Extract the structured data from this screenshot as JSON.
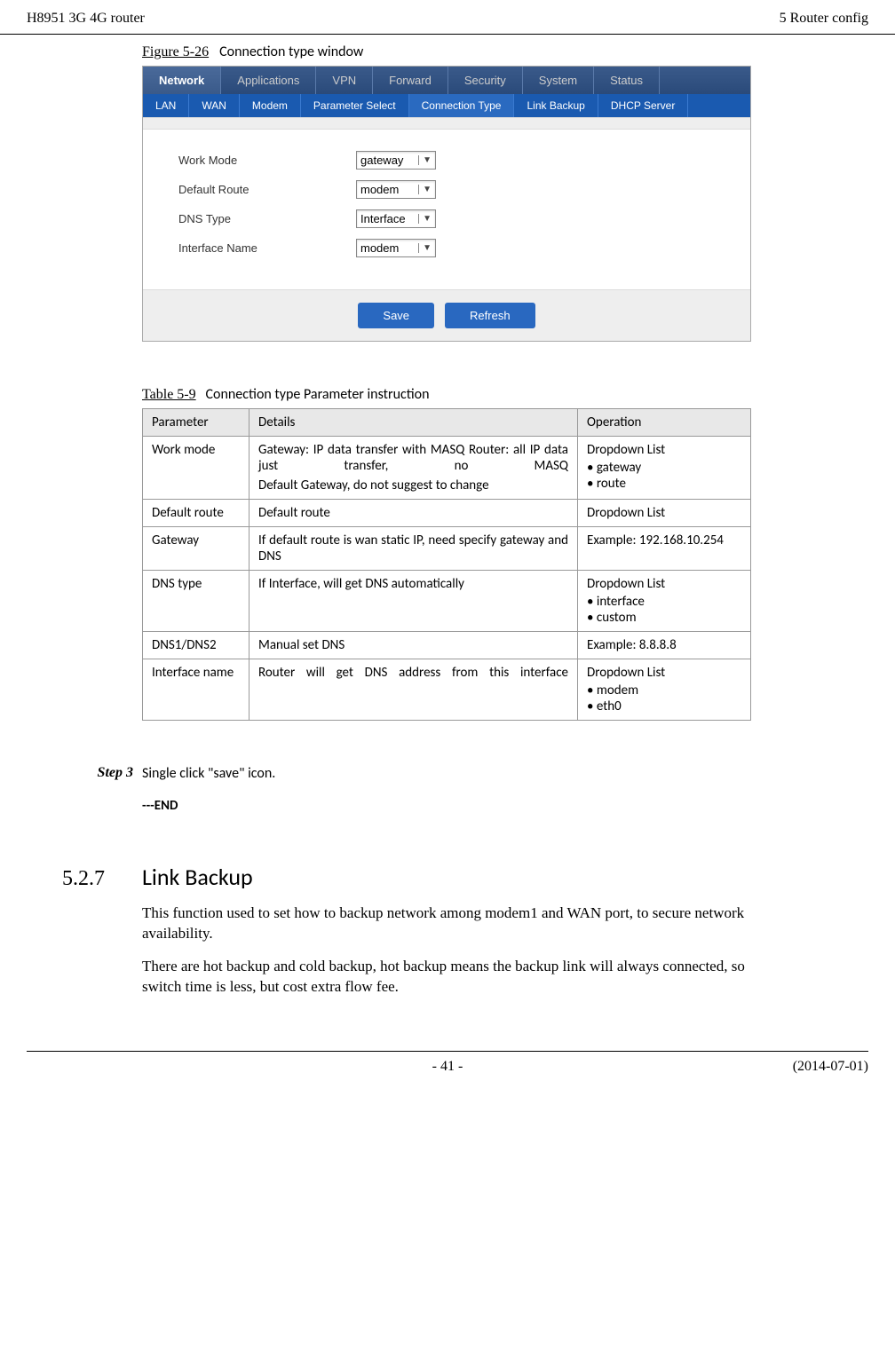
{
  "header": {
    "left": "H8951 3G 4G router",
    "right": "5  Router config"
  },
  "figure": {
    "label": "Figure 5-26",
    "title": "Connection type window"
  },
  "main_tabs": [
    "Network",
    "Applications",
    "VPN",
    "Forward",
    "Security",
    "System",
    "Status"
  ],
  "main_tab_active_index": 0,
  "sub_tabs": [
    "LAN",
    "WAN",
    "Modem",
    "Parameter Select",
    "Connection Type",
    "Link Backup",
    "DHCP Server"
  ],
  "sub_tab_active_index": 4,
  "form_fields": [
    {
      "label": "Work Mode",
      "value": "gateway"
    },
    {
      "label": "Default Route",
      "value": "modem"
    },
    {
      "label": "DNS Type",
      "value": "Interface"
    },
    {
      "label": "Interface Name",
      "value": "modem"
    }
  ],
  "buttons": {
    "save": "Save",
    "refresh": "Refresh"
  },
  "table": {
    "label": "Table 5-9",
    "title": "Connection type Parameter instruction",
    "headers": [
      "Parameter",
      "Details",
      "Operation"
    ],
    "rows": [
      {
        "param": "Work mode",
        "details_lines": [
          "Gateway: IP data transfer with MASQ Router: all IP data just transfer, no MASQ",
          "Default Gateway, do not suggest to change"
        ],
        "details_spread": [
          true,
          false
        ],
        "operation_text": "Dropdown List",
        "operation_bullets": [
          "gateway",
          "route"
        ]
      },
      {
        "param": "Default route",
        "details_lines": [
          "Default route"
        ],
        "details_spread": [
          false
        ],
        "operation_text": "Dropdown List",
        "operation_bullets": []
      },
      {
        "param": "Gateway",
        "details_lines": [
          "If default route is wan static IP, need specify gateway and DNS"
        ],
        "details_spread": [
          true
        ],
        "operation_text": "Example: 192.168.10.254",
        "operation_bullets": []
      },
      {
        "param": "DNS type",
        "details_lines": [
          "If Interface, will get DNS automatically"
        ],
        "details_spread": [
          false
        ],
        "operation_text": "Dropdown List",
        "operation_bullets": [
          "interface",
          "custom"
        ]
      },
      {
        "param": "DNS1/DNS2",
        "details_lines": [
          "Manual set DNS"
        ],
        "details_spread": [
          false
        ],
        "operation_text": "Example: 8.8.8.8",
        "operation_bullets": []
      },
      {
        "param": "Interface name",
        "details_lines": [
          "Router will get DNS address from this interface"
        ],
        "details_spread": [
          true
        ],
        "operation_text": "Dropdown List",
        "operation_bullets": [
          "modem",
          "eth0"
        ]
      }
    ]
  },
  "step": {
    "label": "Step 3",
    "text": "Single click \"save\" icon."
  },
  "end_marker": "---END",
  "section": {
    "num": "5.2.7",
    "title": "Link Backup"
  },
  "paragraphs": [
    "This function used to set how to backup network among modem1 and WAN port, to secure network availability.",
    "There are hot backup and cold backup, hot backup means the backup link will always connected, so switch time is less, but cost extra flow fee."
  ],
  "footer": {
    "page": "- 41 -",
    "date": "(2014-07-01)"
  }
}
